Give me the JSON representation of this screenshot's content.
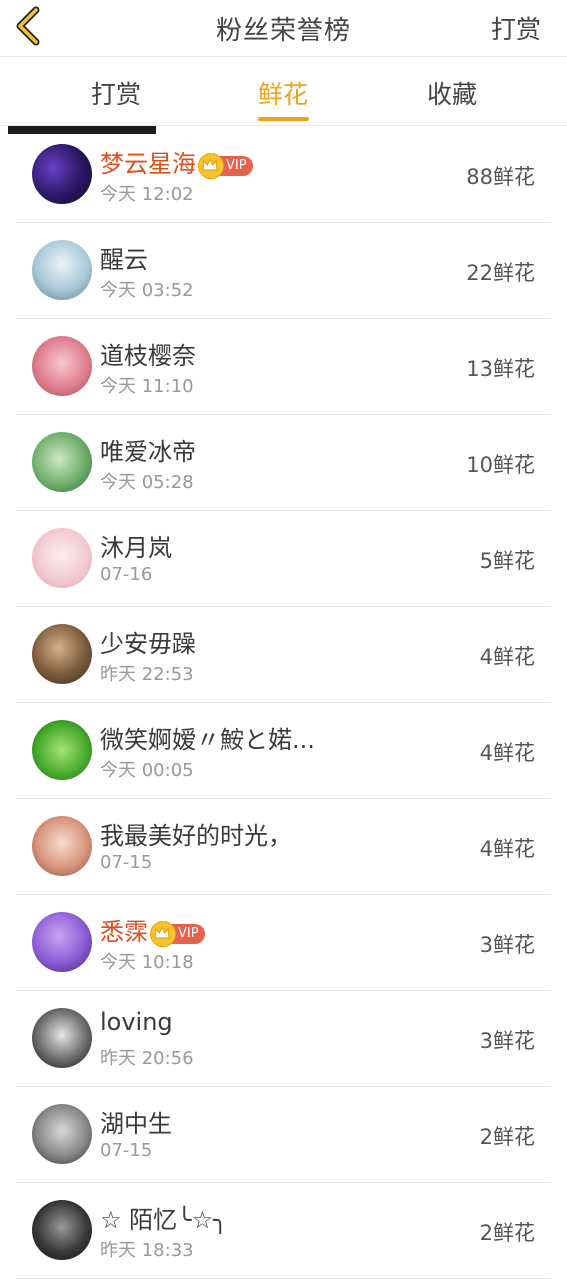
{
  "header": {
    "title": "粉丝荣誉榜",
    "action": "打赏"
  },
  "tabs": [
    {
      "label": "打赏",
      "active": false
    },
    {
      "label": "鲜花",
      "active": true
    },
    {
      "label": "收藏",
      "active": false
    }
  ],
  "accent": "#f4a019",
  "vip_name_color": "#e04e1d",
  "vip_label": "VIP",
  "fans": [
    {
      "name": "梦云星海",
      "vip": true,
      "time": "今天 12:02",
      "count": "88鲜花"
    },
    {
      "name": "醒云",
      "vip": false,
      "time": "今天 03:52",
      "count": "22鲜花"
    },
    {
      "name": "道枝樱奈",
      "vip": false,
      "time": "今天 11:10",
      "count": "13鲜花"
    },
    {
      "name": "唯爱冰帝",
      "vip": false,
      "time": "今天 05:28",
      "count": "10鲜花"
    },
    {
      "name": "沐月岚",
      "vip": false,
      "time": "07-16",
      "count": "5鲜花"
    },
    {
      "name": "少安毋躁",
      "vip": false,
      "time": "昨天 22:53",
      "count": "4鲜花"
    },
    {
      "name": "微笑婀嫒〃鮟と婼...",
      "vip": false,
      "time": "今天 00:05",
      "count": "4鲜花"
    },
    {
      "name": "我最美好的时光，",
      "vip": false,
      "time": "07-15",
      "count": "4鲜花"
    },
    {
      "name": "悉霂",
      "vip": true,
      "time": "今天 10:18",
      "count": "3鲜花"
    },
    {
      "name": "loving",
      "vip": false,
      "time": "昨天 20:56",
      "count": "3鲜花"
    },
    {
      "name": "湖中生",
      "vip": false,
      "time": "07-15",
      "count": "2鲜花"
    },
    {
      "name": "☆ 陌忆╰☆╮",
      "vip": false,
      "time": "昨天 18:33",
      "count": "2鲜花"
    }
  ]
}
